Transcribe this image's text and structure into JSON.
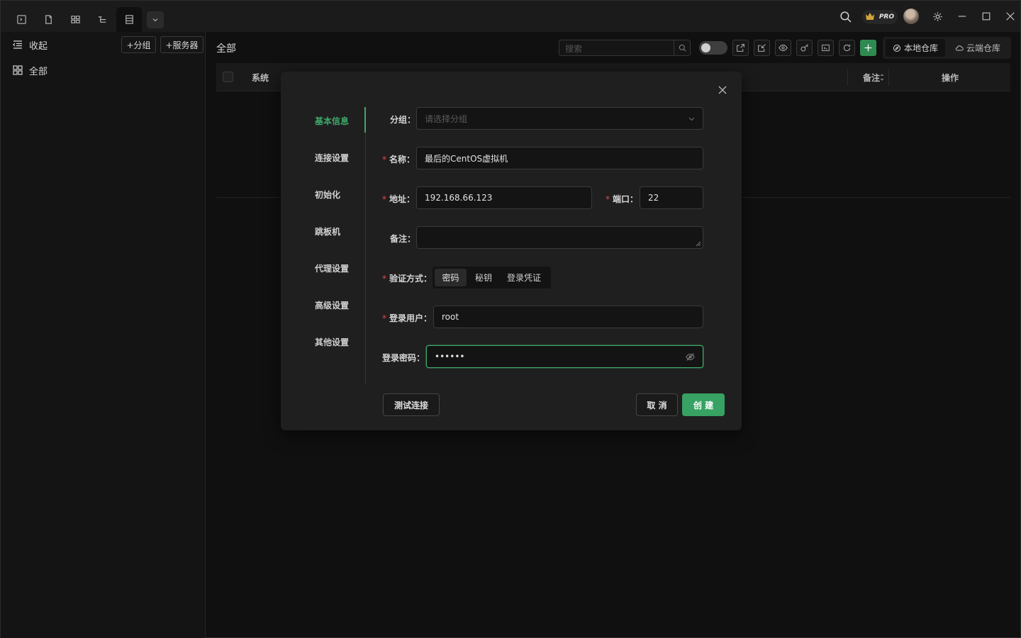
{
  "sidebar": {
    "collapse_label": "收起",
    "all_label": "全部",
    "add_group_label": "+分组",
    "add_server_label": "+服务器"
  },
  "header": {
    "pro_label": "PRO"
  },
  "main": {
    "title": "全部",
    "search_placeholder": "搜索",
    "repo_local_label": "本地仓库",
    "repo_cloud_label": "云端仓库",
    "columns": [
      "系统",
      "备注",
      "操作"
    ]
  },
  "modal": {
    "nav": [
      "基本信息",
      "连接设置",
      "初始化",
      "跳板机",
      "代理设置",
      "高级设置",
      "其他设置"
    ],
    "group_label": "分组：",
    "group_placeholder": "请选择分组",
    "name_label": "名称：",
    "name_value": "最后的CentOS虚拟机",
    "address_label": "地址：",
    "address_value": "192.168.66.123",
    "port_label": "端口：",
    "port_value": "22",
    "remark_label": "备注：",
    "remark_value": "",
    "auth_label": "验证方式：",
    "auth_options": [
      "密码",
      "秘钥",
      "登录凭证"
    ],
    "user_label": "登录用户：",
    "user_value": "root",
    "password_label": "登录密码：",
    "password_value": "••••••",
    "test_button": "测试连接",
    "cancel_button": "取 消",
    "create_button": "创 建",
    "required_mark": "*"
  },
  "colors": {
    "accent": "#3ea86a",
    "required": "#e0494b",
    "bg": "#101010",
    "modal_bg": "#1f1f1f"
  }
}
